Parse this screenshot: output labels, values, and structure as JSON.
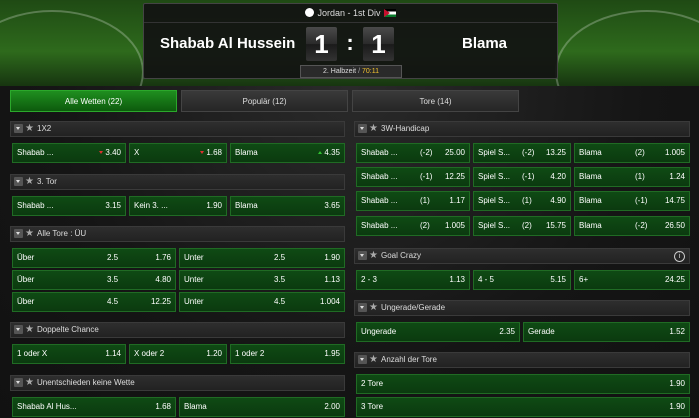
{
  "match": {
    "league": "Jordan - 1st Div",
    "home_team": "Shabab Al Hussein",
    "away_team": "Blama",
    "home_score": "1",
    "away_score": "1",
    "colon": ":",
    "period": "2. Halbzeit",
    "period_sep": "/",
    "clock": "70:11"
  },
  "tabs": [
    {
      "label": "Alle Wetten (22)",
      "active": true
    },
    {
      "label": "Populär (12)",
      "active": false
    },
    {
      "label": "Tore (14)",
      "active": false
    }
  ],
  "sections": {
    "s1x2": {
      "title": "1X2",
      "cells": [
        {
          "label": "Shabab ...",
          "odd": "3.40",
          "trend": "down"
        },
        {
          "label": "X",
          "odd": "1.68",
          "trend": "down"
        },
        {
          "label": "Blama",
          "odd": "4.35",
          "trend": "up"
        }
      ]
    },
    "third_goal": {
      "title": "3. Tor",
      "cells": [
        {
          "label": "Shabab ...",
          "odd": "3.15"
        },
        {
          "label": "Kein 3. ...",
          "odd": "1.90"
        },
        {
          "label": "Blama",
          "odd": "3.65"
        }
      ]
    },
    "all_goals": {
      "title": "Alle Tore : ÜU",
      "rows": [
        {
          "left": {
            "label": "Über",
            "line": "2.5",
            "odd": "1.76"
          },
          "right": {
            "label": "Unter",
            "line": "2.5",
            "odd": "1.90"
          }
        },
        {
          "left": {
            "label": "Über",
            "line": "3.5",
            "odd": "4.80"
          },
          "right": {
            "label": "Unter",
            "line": "3.5",
            "odd": "1.13"
          }
        },
        {
          "left": {
            "label": "Über",
            "line": "4.5",
            "odd": "12.25"
          },
          "right": {
            "label": "Unter",
            "line": "4.5",
            "odd": "1.004"
          }
        }
      ]
    },
    "double_chance": {
      "title": "Doppelte Chance",
      "cells": [
        {
          "label": "1 oder X",
          "odd": "1.14"
        },
        {
          "label": "X oder 2",
          "odd": "1.20"
        },
        {
          "label": "1 oder 2",
          "odd": "1.95"
        }
      ]
    },
    "draw_no_bet": {
      "title": "Unentschieden keine Wette",
      "cells": [
        {
          "label": "Shabab Al Hus...",
          "odd": "1.68"
        },
        {
          "label": "Blama",
          "odd": "2.00"
        }
      ]
    },
    "handicap": {
      "title": "3W-Handicap",
      "rows": [
        [
          {
            "label": "Shabab ...",
            "line": "(-2)",
            "odd": "25.00"
          },
          {
            "label": "Spiel S...",
            "line": "(-2)",
            "odd": "13.25"
          },
          {
            "label": "Blama",
            "line": "(2)",
            "odd": "1.005"
          }
        ],
        [
          {
            "label": "Shabab ...",
            "line": "(-1)",
            "odd": "12.25"
          },
          {
            "label": "Spiel S...",
            "line": "(-1)",
            "odd": "4.20"
          },
          {
            "label": "Blama",
            "line": "(1)",
            "odd": "1.24"
          }
        ],
        [
          {
            "label": "Shabab ...",
            "line": "(1)",
            "odd": "1.17"
          },
          {
            "label": "Spiel S...",
            "line": "(1)",
            "odd": "4.90"
          },
          {
            "label": "Blama",
            "line": "(-1)",
            "odd": "14.75"
          }
        ],
        [
          {
            "label": "Shabab ...",
            "line": "(2)",
            "odd": "1.005"
          },
          {
            "label": "Spiel S...",
            "line": "(2)",
            "odd": "15.75"
          },
          {
            "label": "Blama",
            "line": "(-2)",
            "odd": "26.50"
          }
        ]
      ]
    },
    "goal_crazy": {
      "title": "Goal Crazy",
      "info": "i",
      "cells": [
        {
          "label": "2 - 3",
          "odd": "1.13"
        },
        {
          "label": "4 - 5",
          "odd": "5.15"
        },
        {
          "label": "6+",
          "odd": "24.25"
        }
      ]
    },
    "odd_even": {
      "title": "Ungerade/Gerade",
      "cells": [
        {
          "label": "Ungerade",
          "odd": "2.35"
        },
        {
          "label": "Gerade",
          "odd": "1.52"
        }
      ]
    },
    "goal_count": {
      "title": "Anzahl der Tore",
      "cells": [
        {
          "label": "2 Tore",
          "odd": "1.90"
        },
        {
          "label": "3 Tore",
          "odd": "1.90"
        }
      ]
    }
  },
  "icons": {
    "star": "★"
  }
}
